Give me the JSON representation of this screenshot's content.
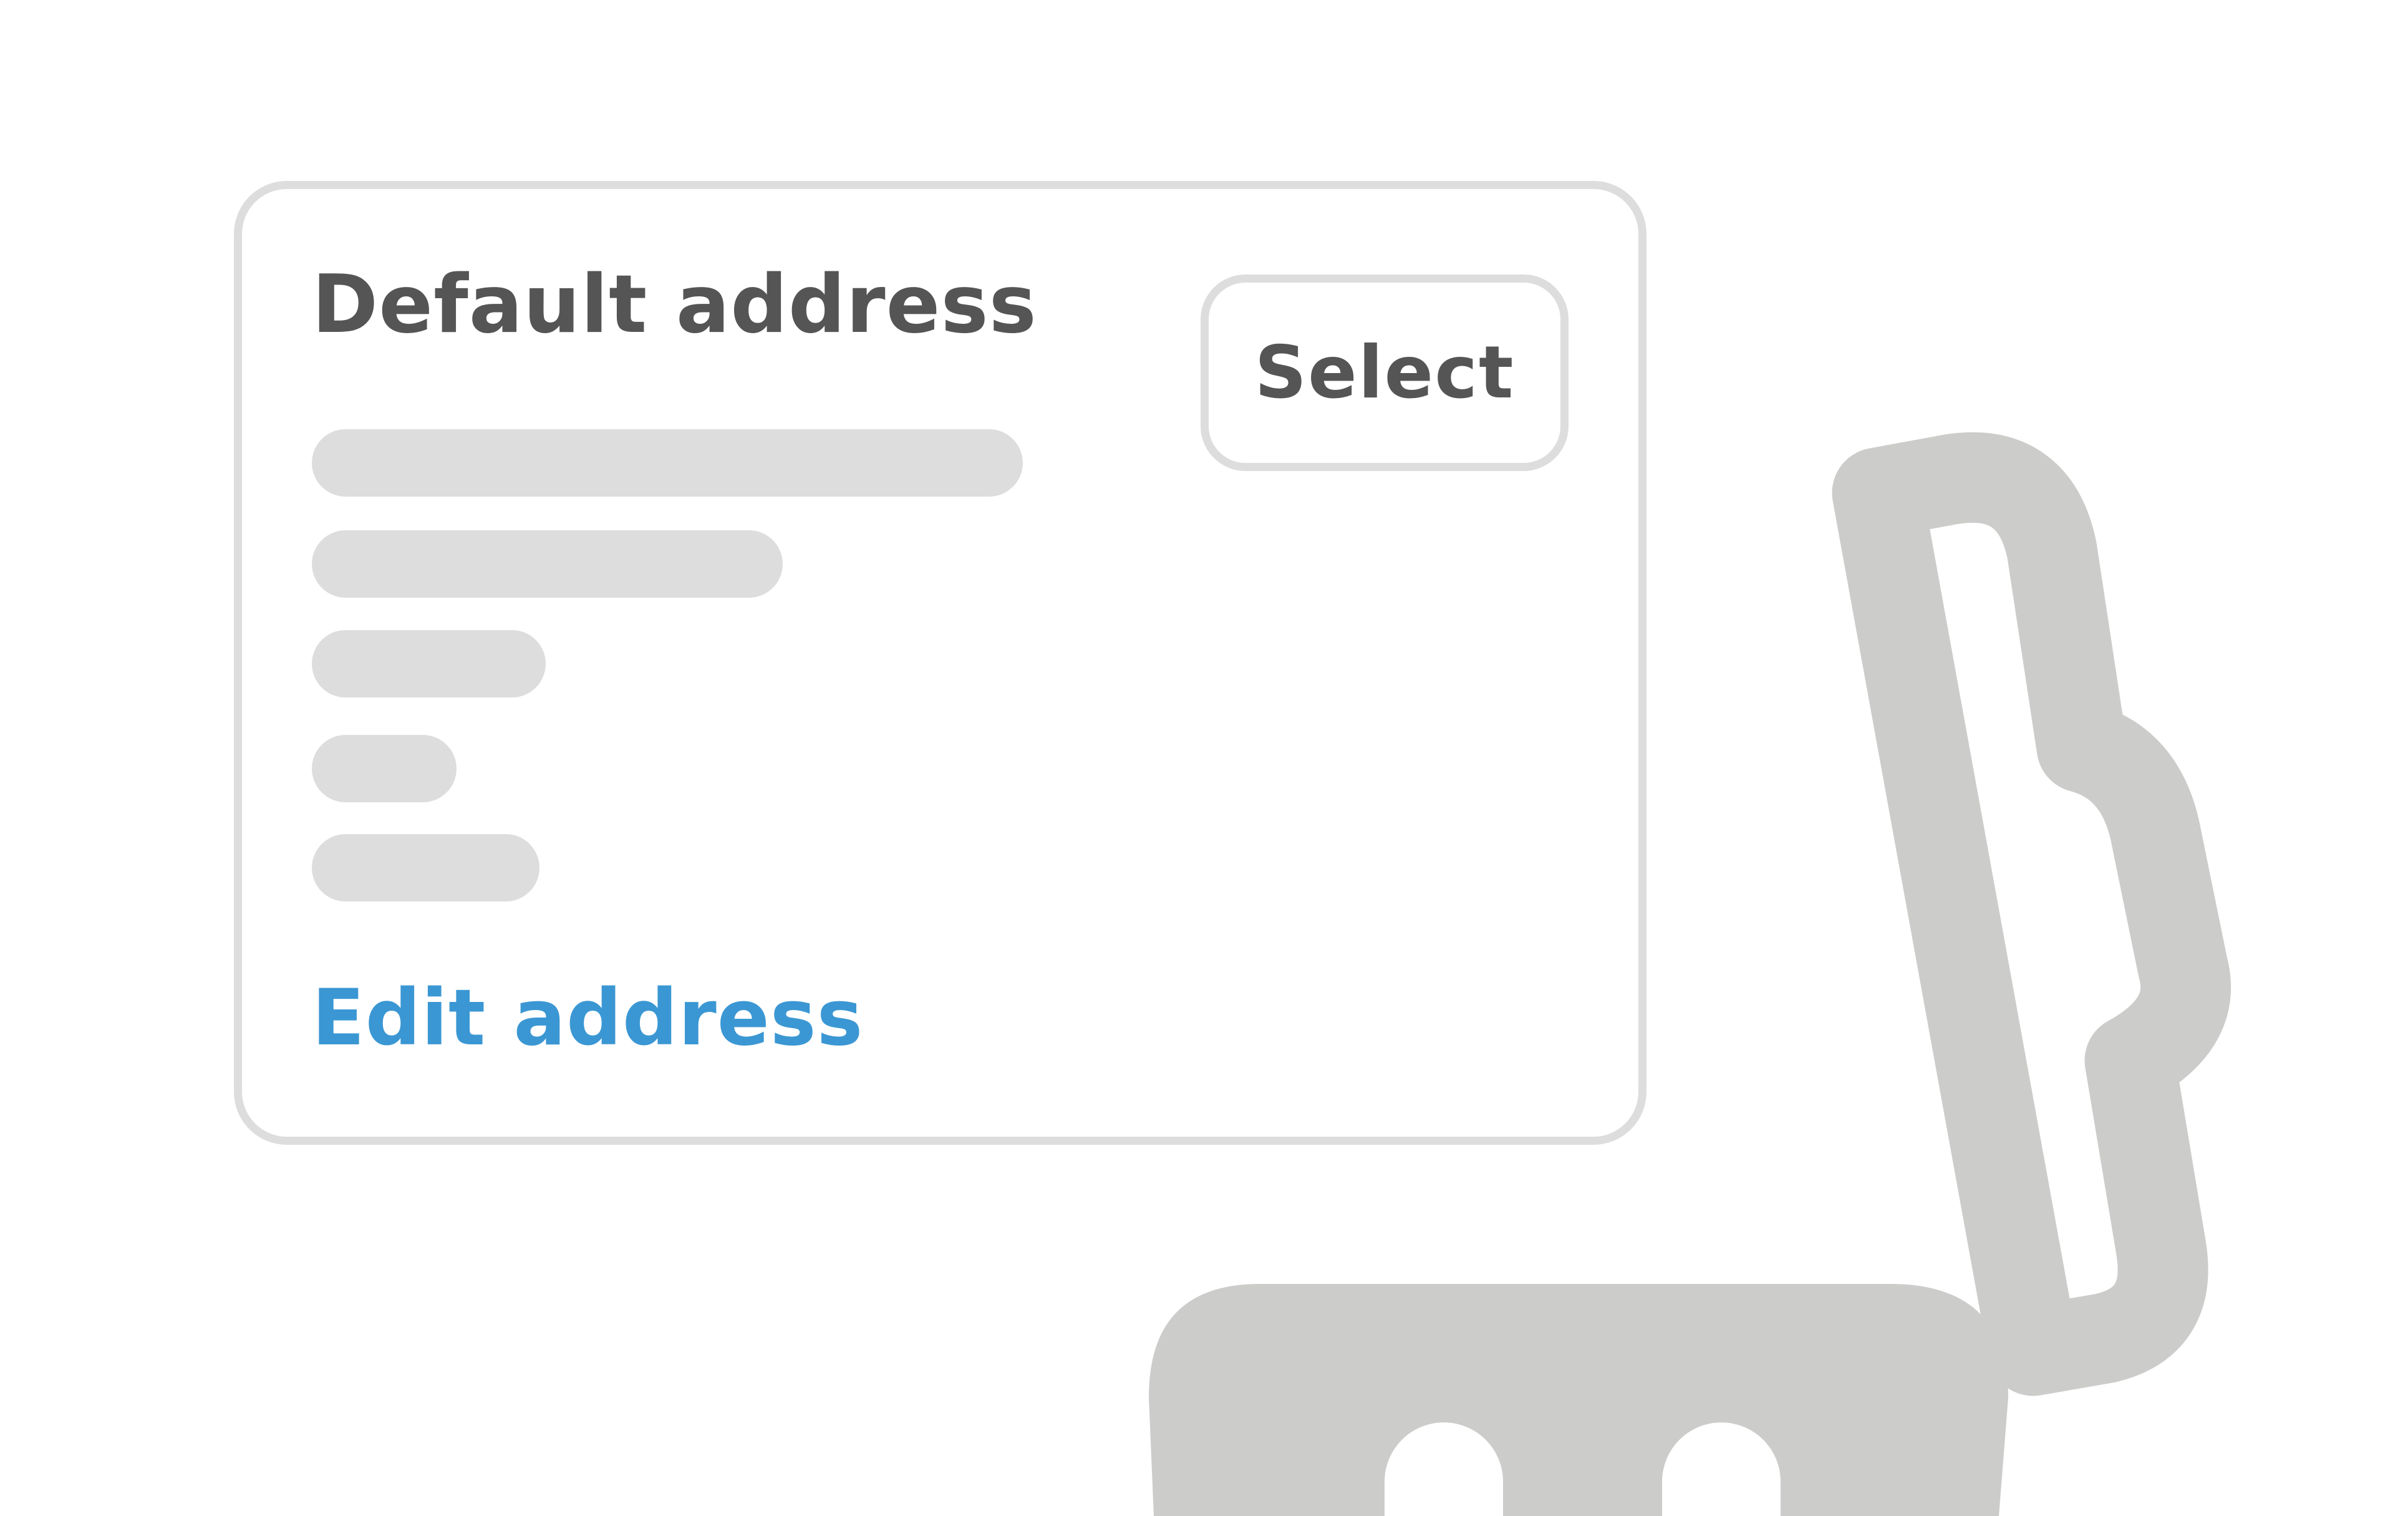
{
  "address_card": {
    "title": "Default address",
    "select_label": "Select",
    "placeholder_line_count": 5,
    "edit_link_label": "Edit address"
  },
  "colors": {
    "text_dark": "#555555",
    "link_blue": "#3b97d3",
    "border_gray": "#dddddd",
    "illustration_gray": "#cccccb",
    "background": "#ffffff"
  },
  "icons": {
    "illustration": "open-mailbox-icon"
  }
}
